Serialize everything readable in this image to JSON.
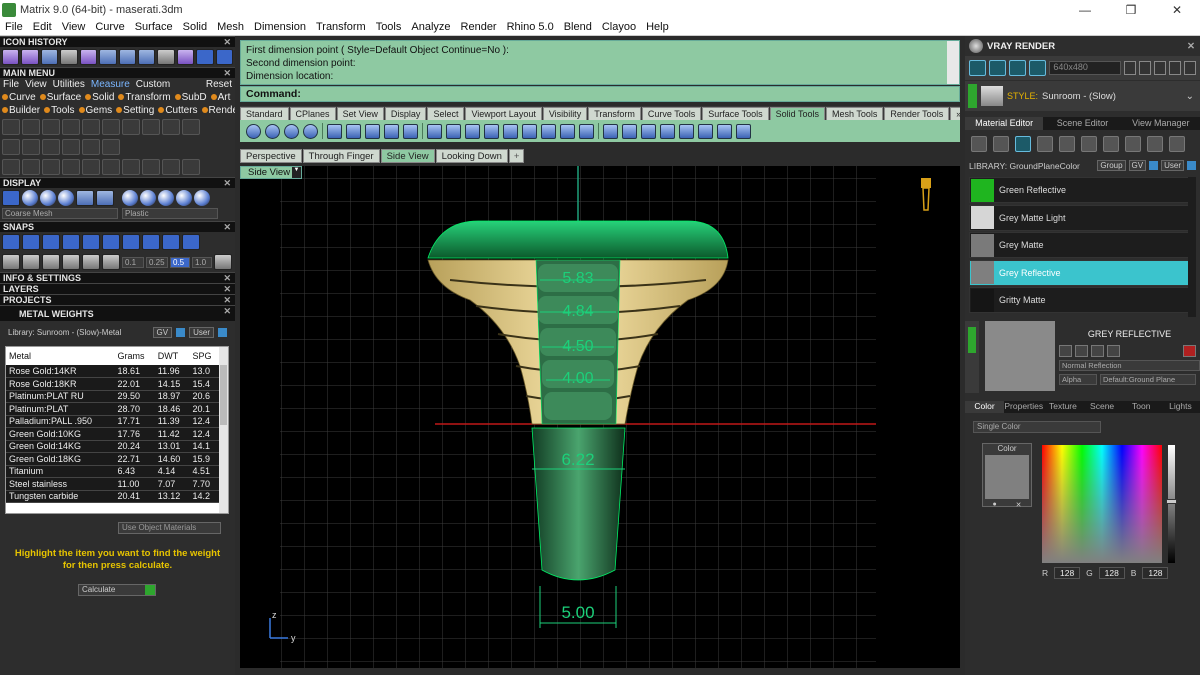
{
  "window": {
    "title": "Matrix 9.0 (64-bit) - maserati.3dm",
    "min": "—",
    "max": "❒",
    "close": "✕"
  },
  "menu": [
    "File",
    "Edit",
    "View",
    "Curve",
    "Surface",
    "Solid",
    "Mesh",
    "Dimension",
    "Transform",
    "Tools",
    "Analyze",
    "Render",
    "Rhino 5.0",
    "Blend",
    "Clayoo",
    "Help"
  ],
  "left": {
    "icon_history": "ICON HISTORY",
    "main_menu": "MAIN MENU",
    "mm_row1": {
      "items": [
        "File",
        "View",
        "Utilities",
        "Measure",
        "Custom"
      ],
      "selected": "Measure",
      "right": "Reset"
    },
    "mm_row2": [
      "Curve",
      "Surface",
      "Solid",
      "Transform",
      "SubD",
      "Art"
    ],
    "mm_row3": [
      "Builder",
      "Tools",
      "Gems",
      "Setting",
      "Cutters",
      "Render"
    ],
    "display": "DISPLAY",
    "display_combo1": "Coarse Mesh",
    "display_combo2": "Plastic",
    "snaps": "SNAPS",
    "snap_values": [
      "0.1",
      "0.25",
      "0.5",
      "1.0"
    ],
    "info_settings": "INFO & SETTINGS",
    "layers": "LAYERS",
    "projects": "PROJECTS",
    "metal_weights": "METAL WEIGHTS",
    "mw_library": "Library: Sunroom - (Slow)-Metal",
    "mw_gv": "GV",
    "mw_user": "User",
    "mw_headers": [
      "Metal",
      "Grams",
      "DWT",
      "SPG"
    ],
    "mw_rows": [
      [
        "Rose Gold:14KR",
        "18.61",
        "11.96",
        "13.0"
      ],
      [
        "Rose Gold:18KR",
        "22.01",
        "14.15",
        "15.4"
      ],
      [
        "Platinum:PLAT RU",
        "29.50",
        "18.97",
        "20.6"
      ],
      [
        "Platinum:PLAT",
        "28.70",
        "18.46",
        "20.1"
      ],
      [
        "Palladium:PALL .950",
        "17.71",
        "11.39",
        "12.4"
      ],
      [
        "Green Gold:10KG",
        "17.76",
        "11.42",
        "12.4"
      ],
      [
        "Green Gold:14KG",
        "20.24",
        "13.01",
        "14.1"
      ],
      [
        "Green Gold:18KG",
        "22.71",
        "14.60",
        "15.9"
      ],
      [
        "Titanium",
        "6.43",
        "4.14",
        "4.51"
      ],
      [
        "Steel stainless",
        "11.00",
        "7.07",
        "7.70"
      ],
      [
        "Tungsten carbide",
        "20.41",
        "13.12",
        "14.2"
      ]
    ],
    "use_object_materials": "Use Object Materials",
    "hint_line1": "Highlight the item you want to find the weight",
    "hint_line2": "for then press calculate.",
    "calculate": "Calculate"
  },
  "center": {
    "history": [
      "First dimension point ( Style=Default  Object  Continue=No ):",
      "Second dimension point:",
      "Dimension location:"
    ],
    "command_label": "Command:",
    "tool_tabs": [
      "Standard",
      "CPlanes",
      "Set View",
      "Display",
      "Select",
      "Viewport Layout",
      "Visibility",
      "Transform",
      "Curve Tools",
      "Surface Tools",
      "Solid Tools",
      "Mesh Tools",
      "Render Tools"
    ],
    "active_tool_tab": "Solid Tools",
    "tabs_more": "»",
    "view_tabs": [
      "Perspective",
      "Through Finger",
      "Side View",
      "Looking Down"
    ],
    "active_view_tab": "Side View",
    "view_add": "+",
    "viewport_label": "Side View",
    "dimensions": [
      "5.83",
      "4.84",
      "4.50",
      "4.00",
      "6.22",
      "5.00"
    ],
    "axis_z": "z",
    "axis_y": "y"
  },
  "right": {
    "vray_title": "VRAY RENDER",
    "resolution": "640x480",
    "style_label": "STYLE:",
    "style_value": "Sunroom - (Slow)",
    "tabs": [
      "Material Editor",
      "Scene Editor",
      "View Manager"
    ],
    "library_label": "LIBRARY: GroundPlaneColor",
    "lib_group": "Group",
    "lib_gv": "GV",
    "lib_user": "User",
    "materials": [
      {
        "name": "Green Reflective",
        "color": "#1fb51f"
      },
      {
        "name": "Grey Matte Light",
        "color": "#d6d6d6"
      },
      {
        "name": "Grey Matte",
        "color": "#7a7a7a"
      },
      {
        "name": "Grey Reflective",
        "color": "#7f7f7f"
      },
      {
        "name": "Gritty Matte",
        "color": "#151515"
      }
    ],
    "selected_material": "Grey Reflective",
    "grey_title": "GREY REFLECTIVE",
    "normal_reflection": "Normal Reflection",
    "alpha_label": "Alpha",
    "default_ground": "Default:Ground Plane",
    "color_tabs": [
      "Color",
      "Properties",
      "Texture",
      "Scene",
      "Toon",
      "Lights"
    ],
    "single_color": "Single Color",
    "color_label": "Color",
    "r_label": "R",
    "g_label": "G",
    "b_label": "B",
    "r": "128",
    "g": "128",
    "b": "128"
  }
}
